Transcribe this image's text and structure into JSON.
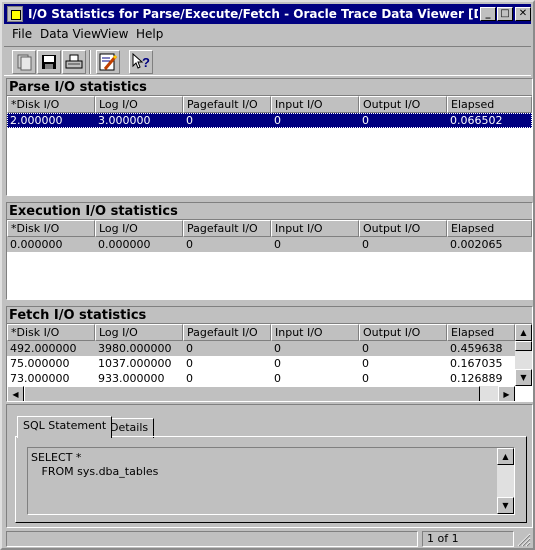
{
  "window": {
    "title": "I/O Statistics for Parse/Execute/Fetch - Oracle Trace Data Viewer [Drill-dow...",
    "min_label": "_",
    "max_label": "□",
    "close_label": "✕"
  },
  "menu": [
    {
      "label": "File"
    },
    {
      "label": "Data View"
    },
    {
      "label": "View"
    },
    {
      "label": "Help"
    }
  ],
  "toolbar_icons": [
    "open-icon",
    "save-icon",
    "print-icon",
    "edit-icon",
    "context-help-icon"
  ],
  "columns": [
    "*Disk I/O",
    "Log I/O",
    "Pagefault I/O",
    "Input I/O",
    "Output I/O",
    "Elapsed"
  ],
  "parse": {
    "title": "Parse I/O statistics",
    "rows": [
      [
        "2.000000",
        "3.000000",
        "0",
        "0",
        "0",
        "0.066502"
      ]
    ]
  },
  "execute": {
    "title": "Execution I/O statistics",
    "rows": [
      [
        "0.000000",
        "0.000000",
        "0",
        "0",
        "0",
        "0.002065"
      ]
    ]
  },
  "fetch": {
    "title": "Fetch I/O statistics",
    "rows": [
      [
        "492.000000",
        "3980.000000",
        "0",
        "0",
        "0",
        "0.459638"
      ],
      [
        "75.000000",
        "1037.000000",
        "0",
        "0",
        "0",
        "0.167035"
      ],
      [
        "73.000000",
        "933.000000",
        "0",
        "0",
        "0",
        "0.126889"
      ]
    ]
  },
  "tabs": [
    {
      "label": "SQL Statement"
    },
    {
      "label": "Details"
    }
  ],
  "sql": {
    "line1": "SELECT *",
    "line2": "   FROM sys.dba_tables"
  },
  "status": {
    "page": "1 of 1"
  }
}
